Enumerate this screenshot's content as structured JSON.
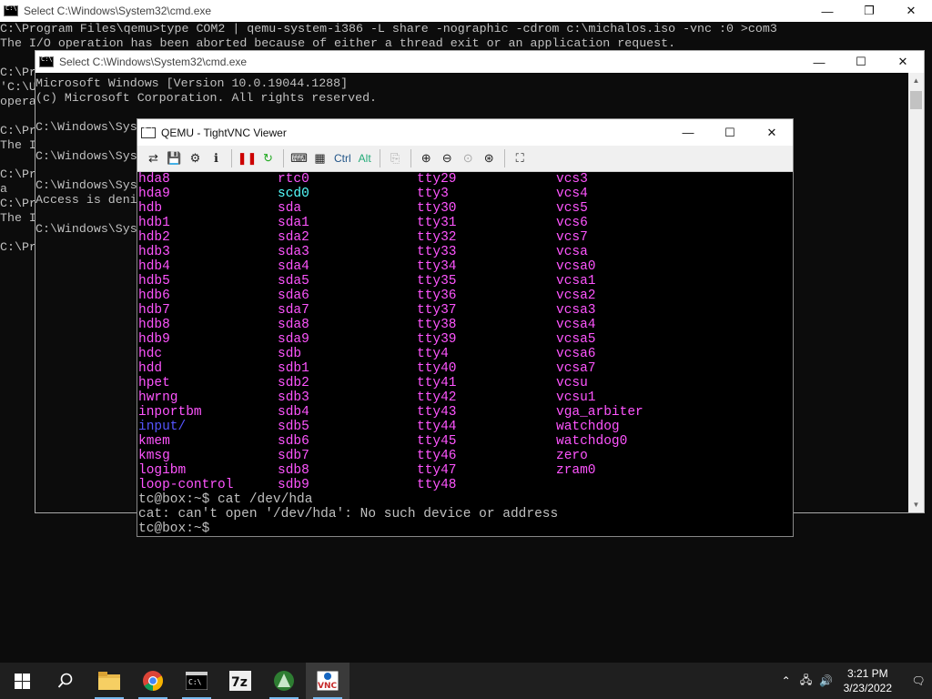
{
  "back_window": {
    "title": "Select C:\\Windows\\System32\\cmd.exe",
    "lines": [
      "C:\\Program Files\\qemu>type COM2 | qemu-system-i386 -L share -nographic -cdrom c:\\michalos.iso -vnc :0 >com3",
      "The I/O operation has been aborted because of either a thread exit or an application request.",
      "",
      "C:\\Pr",
      "'C:\\U",
      "opera",
      "",
      "C:\\Pr",
      "The I",
      "",
      "C:\\Pr",
      "a",
      "C:\\Pr",
      "The I",
      "",
      "C:\\Pr"
    ]
  },
  "mid_window": {
    "title": "Select C:\\Windows\\System32\\cmd.exe",
    "lines": [
      "Microsoft Windows [Version 10.0.19044.1288]",
      "(c) Microsoft Corporation. All rights reserved.",
      "",
      "C:\\Windows\\Sys",
      "",
      "C:\\Windows\\Sys",
      "",
      "C:\\Windows\\Sys",
      "Access is deni",
      "",
      "C:\\Windows\\Sys"
    ]
  },
  "vnc": {
    "title": "QEMU - TightVNC Viewer",
    "toolbar": {
      "ctrl_label": "Ctrl",
      "alt_label": "Alt"
    },
    "rows": [
      [
        {
          "t": "hda8",
          "c": "mag"
        },
        {
          "t": "rtc0",
          "c": "mag"
        },
        {
          "t": "tty29",
          "c": "mag"
        },
        {
          "t": "vcs3",
          "c": "mag"
        }
      ],
      [
        {
          "t": "hda9",
          "c": "mag"
        },
        {
          "t": "scd0",
          "c": "cyan"
        },
        {
          "t": "tty3",
          "c": "mag"
        },
        {
          "t": "vcs4",
          "c": "mag"
        }
      ],
      [
        {
          "t": "hdb",
          "c": "mag"
        },
        {
          "t": "sda",
          "c": "mag"
        },
        {
          "t": "tty30",
          "c": "mag"
        },
        {
          "t": "vcs5",
          "c": "mag"
        }
      ],
      [
        {
          "t": "hdb1",
          "c": "mag"
        },
        {
          "t": "sda1",
          "c": "mag"
        },
        {
          "t": "tty31",
          "c": "mag"
        },
        {
          "t": "vcs6",
          "c": "mag"
        }
      ],
      [
        {
          "t": "hdb2",
          "c": "mag"
        },
        {
          "t": "sda2",
          "c": "mag"
        },
        {
          "t": "tty32",
          "c": "mag"
        },
        {
          "t": "vcs7",
          "c": "mag"
        }
      ],
      [
        {
          "t": "hdb3",
          "c": "mag"
        },
        {
          "t": "sda3",
          "c": "mag"
        },
        {
          "t": "tty33",
          "c": "mag"
        },
        {
          "t": "vcsa",
          "c": "mag"
        }
      ],
      [
        {
          "t": "hdb4",
          "c": "mag"
        },
        {
          "t": "sda4",
          "c": "mag"
        },
        {
          "t": "tty34",
          "c": "mag"
        },
        {
          "t": "vcsa0",
          "c": "mag"
        }
      ],
      [
        {
          "t": "hdb5",
          "c": "mag"
        },
        {
          "t": "sda5",
          "c": "mag"
        },
        {
          "t": "tty35",
          "c": "mag"
        },
        {
          "t": "vcsa1",
          "c": "mag"
        }
      ],
      [
        {
          "t": "hdb6",
          "c": "mag"
        },
        {
          "t": "sda6",
          "c": "mag"
        },
        {
          "t": "tty36",
          "c": "mag"
        },
        {
          "t": "vcsa2",
          "c": "mag"
        }
      ],
      [
        {
          "t": "hdb7",
          "c": "mag"
        },
        {
          "t": "sda7",
          "c": "mag"
        },
        {
          "t": "tty37",
          "c": "mag"
        },
        {
          "t": "vcsa3",
          "c": "mag"
        }
      ],
      [
        {
          "t": "hdb8",
          "c": "mag"
        },
        {
          "t": "sda8",
          "c": "mag"
        },
        {
          "t": "tty38",
          "c": "mag"
        },
        {
          "t": "vcsa4",
          "c": "mag"
        }
      ],
      [
        {
          "t": "hdb9",
          "c": "mag"
        },
        {
          "t": "sda9",
          "c": "mag"
        },
        {
          "t": "tty39",
          "c": "mag"
        },
        {
          "t": "vcsa5",
          "c": "mag"
        }
      ],
      [
        {
          "t": "hdc",
          "c": "mag"
        },
        {
          "t": "sdb",
          "c": "mag"
        },
        {
          "t": "tty4",
          "c": "mag"
        },
        {
          "t": "vcsa6",
          "c": "mag"
        }
      ],
      [
        {
          "t": "hdd",
          "c": "mag"
        },
        {
          "t": "sdb1",
          "c": "mag"
        },
        {
          "t": "tty40",
          "c": "mag"
        },
        {
          "t": "vcsa7",
          "c": "mag"
        }
      ],
      [
        {
          "t": "hpet",
          "c": "mag"
        },
        {
          "t": "sdb2",
          "c": "mag"
        },
        {
          "t": "tty41",
          "c": "mag"
        },
        {
          "t": "vcsu",
          "c": "mag"
        }
      ],
      [
        {
          "t": "hwrng",
          "c": "mag"
        },
        {
          "t": "sdb3",
          "c": "mag"
        },
        {
          "t": "tty42",
          "c": "mag"
        },
        {
          "t": "vcsu1",
          "c": "mag"
        }
      ],
      [
        {
          "t": "inportbm",
          "c": "mag"
        },
        {
          "t": "sdb4",
          "c": "mag"
        },
        {
          "t": "tty43",
          "c": "mag"
        },
        {
          "t": "vga_arbiter",
          "c": "mag"
        }
      ],
      [
        {
          "t": "input/",
          "c": "blue"
        },
        {
          "t": "sdb5",
          "c": "mag"
        },
        {
          "t": "tty44",
          "c": "mag"
        },
        {
          "t": "watchdog",
          "c": "mag"
        }
      ],
      [
        {
          "t": "kmem",
          "c": "mag"
        },
        {
          "t": "sdb6",
          "c": "mag"
        },
        {
          "t": "tty45",
          "c": "mag"
        },
        {
          "t": "watchdog0",
          "c": "mag"
        }
      ],
      [
        {
          "t": "kmsg",
          "c": "mag"
        },
        {
          "t": "sdb7",
          "c": "mag"
        },
        {
          "t": "tty46",
          "c": "mag"
        },
        {
          "t": "zero",
          "c": "mag"
        }
      ],
      [
        {
          "t": "logibm",
          "c": "mag"
        },
        {
          "t": "sdb8",
          "c": "mag"
        },
        {
          "t": "tty47",
          "c": "mag"
        },
        {
          "t": "zram0",
          "c": "mag"
        }
      ],
      [
        {
          "t": "loop-control",
          "c": "mag"
        },
        {
          "t": "sdb9",
          "c": "mag"
        },
        {
          "t": "tty48",
          "c": "mag"
        },
        {
          "t": "",
          "c": "mag"
        }
      ]
    ],
    "tail": [
      "tc@box:~$ cat /dev/hda",
      "cat: can't open '/dev/hda': No such device or address",
      "tc@box:~$ "
    ]
  },
  "taskbar": {
    "time": "3:21 PM",
    "date": "3/23/2022",
    "apps": [
      "start-button",
      "search",
      "file-explorer",
      "chrome",
      "cmd",
      "7zip",
      "app-green",
      "tightvnc"
    ]
  },
  "colors": {
    "magenta": "#ff55ff",
    "cyan": "#55ffff",
    "blue": "#5555ff",
    "accent": "#76b9ed"
  }
}
